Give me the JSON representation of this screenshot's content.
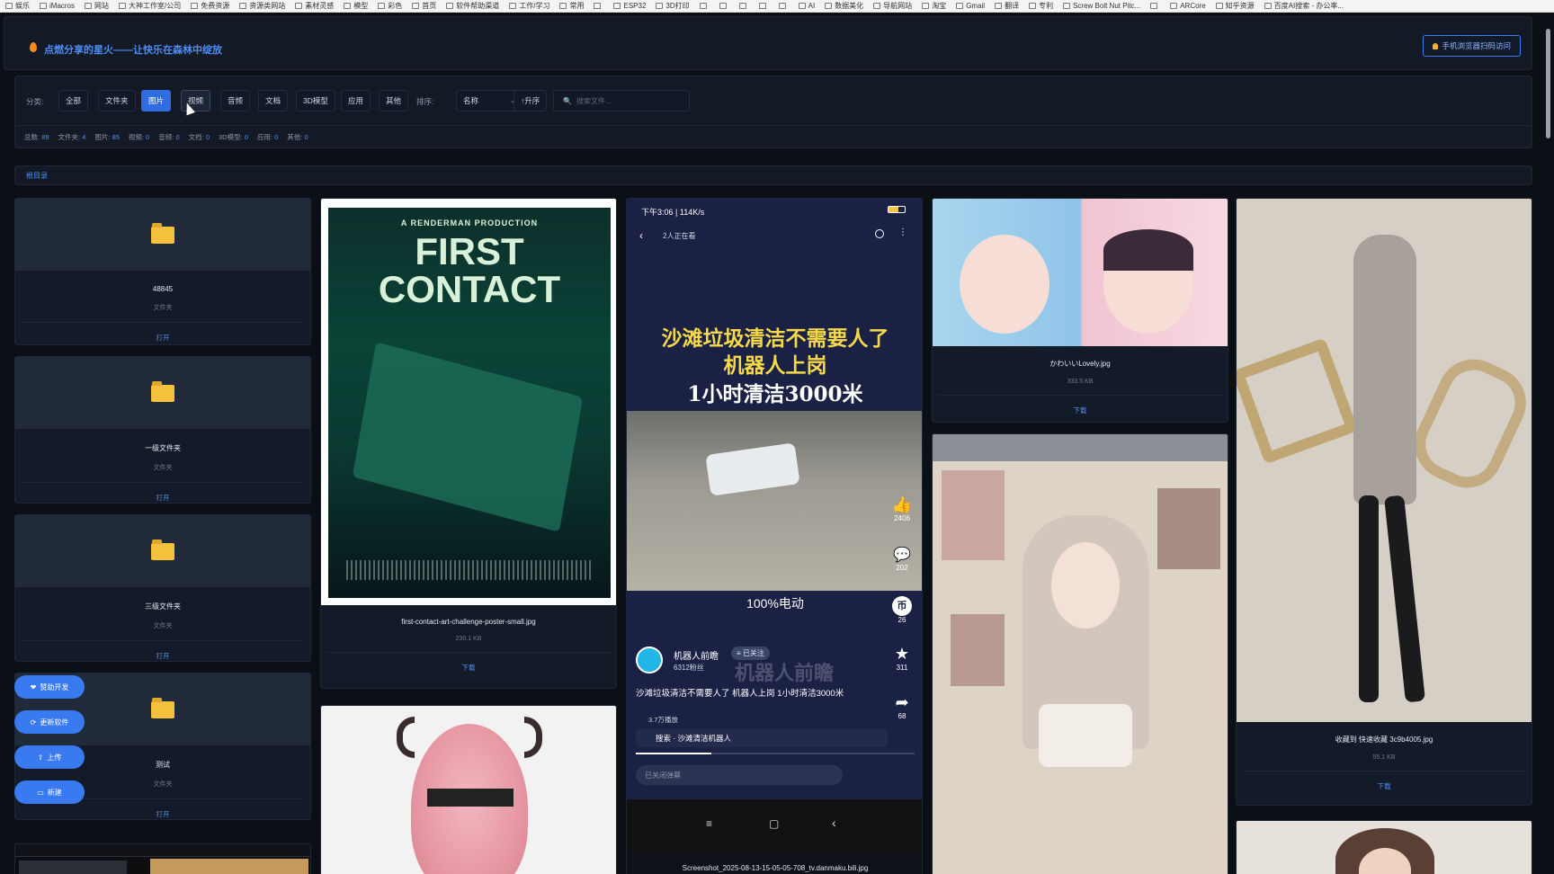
{
  "bookmarks": [
    "娱乐",
    "iMacros",
    "网站",
    "大神工作室/公司",
    "免费资源",
    "资源类网站",
    "素材灵感",
    "模型",
    "彩色",
    "首页",
    "软件帮助渠道",
    "工作/学习",
    "常用",
    "",
    "ESP32",
    "3D打印",
    "",
    "",
    "",
    "",
    "",
    "AI",
    "数据美化",
    "导航网站",
    "淘宝",
    "Gmail",
    "翻译",
    "专利",
    "Screw Bolt Nut Pitc...",
    "",
    "ARCore",
    "知乎资源",
    "百度AI搜索 - 办公率..."
  ],
  "header": {
    "title": "点燃分享的星火——让快乐在森林中绽放",
    "mobile_button": "手机浏览器扫码访问"
  },
  "filters": {
    "category_label": "分类:",
    "categories": [
      "全部",
      "文件夹",
      "图片",
      "视频",
      "音频",
      "文档",
      "3D模型",
      "应用",
      "其他"
    ],
    "active_category": "图片",
    "hover_category": "视频",
    "sort_label": "排序:",
    "sort_value": "名称",
    "order_button": "↑升序",
    "search_placeholder": "搜索文件..."
  },
  "stats": [
    {
      "label": "总数:",
      "value": "89"
    },
    {
      "label": "文件夹:",
      "value": "4"
    },
    {
      "label": "图片:",
      "value": "85"
    },
    {
      "label": "视频:",
      "value": "0"
    },
    {
      "label": "音频:",
      "value": "0"
    },
    {
      "label": "文档:",
      "value": "0"
    },
    {
      "label": "3D模型:",
      "value": "0"
    },
    {
      "label": "应用:",
      "value": "0"
    },
    {
      "label": "其他:",
      "value": "0"
    }
  ],
  "breadcrumb": "根目录",
  "folders": [
    {
      "name": "48845",
      "type": "文件夹",
      "action": "打开"
    },
    {
      "name": "一级文件夹",
      "type": "文件夹",
      "action": "打开"
    },
    {
      "name": "三级文件夹",
      "type": "文件夹",
      "action": "打开"
    },
    {
      "name": "测试",
      "type": "文件夹",
      "action": "打开"
    }
  ],
  "images": [
    {
      "name": "first-contact-art-challenge-poster-small.jpg",
      "size": "230.1 KB",
      "action": "下载"
    },
    {
      "name": "Screenshot_2025-08-13-15-05-05-708_tv.danmaku.bili.jpg"
    },
    {
      "name": "かわいいLovely.jpg",
      "size": "333.5 KB",
      "action": "下载"
    },
    {
      "name": "收藏到 快速收藏 3c9b4005.jpg",
      "size": "55.1 KB",
      "action": "下载"
    }
  ],
  "poster": {
    "top": "A RENDERMAN PRODUCTION",
    "line1": "FIRST",
    "line2": "CONTACT"
  },
  "phone": {
    "time": "下午3:06 | 114K/s",
    "viewers": "2人正在看",
    "headline1": "沙滩垃圾清洁不需要人了",
    "headline2": "机器人上岗",
    "headline3": "1小时清洁3000米",
    "caption": "100%电动",
    "like_count": "2406",
    "comment_count": "202",
    "coin_count": "26",
    "fav_count": "311",
    "share_count": "68",
    "author": "机器人前瞻",
    "author_fans": "6312粉丝",
    "follow_state": "≡ 已关注",
    "watermark": "机器人前瞻",
    "description": "沙滩垃圾清洁不需要人了 机器人上岗 1小时清洁3000米",
    "plays": "3.7万播放",
    "search_text": "搜索 · 沙滩清洁机器人",
    "danmaku_placeholder": "已关闭弹幕"
  },
  "fabs": [
    "赞助开发",
    "更新软件",
    "上传",
    "新建"
  ],
  "colors": {
    "accent": "#3a7af0",
    "background": "#0b0f16",
    "panel": "#131a26",
    "folder": "#f4c13a"
  }
}
